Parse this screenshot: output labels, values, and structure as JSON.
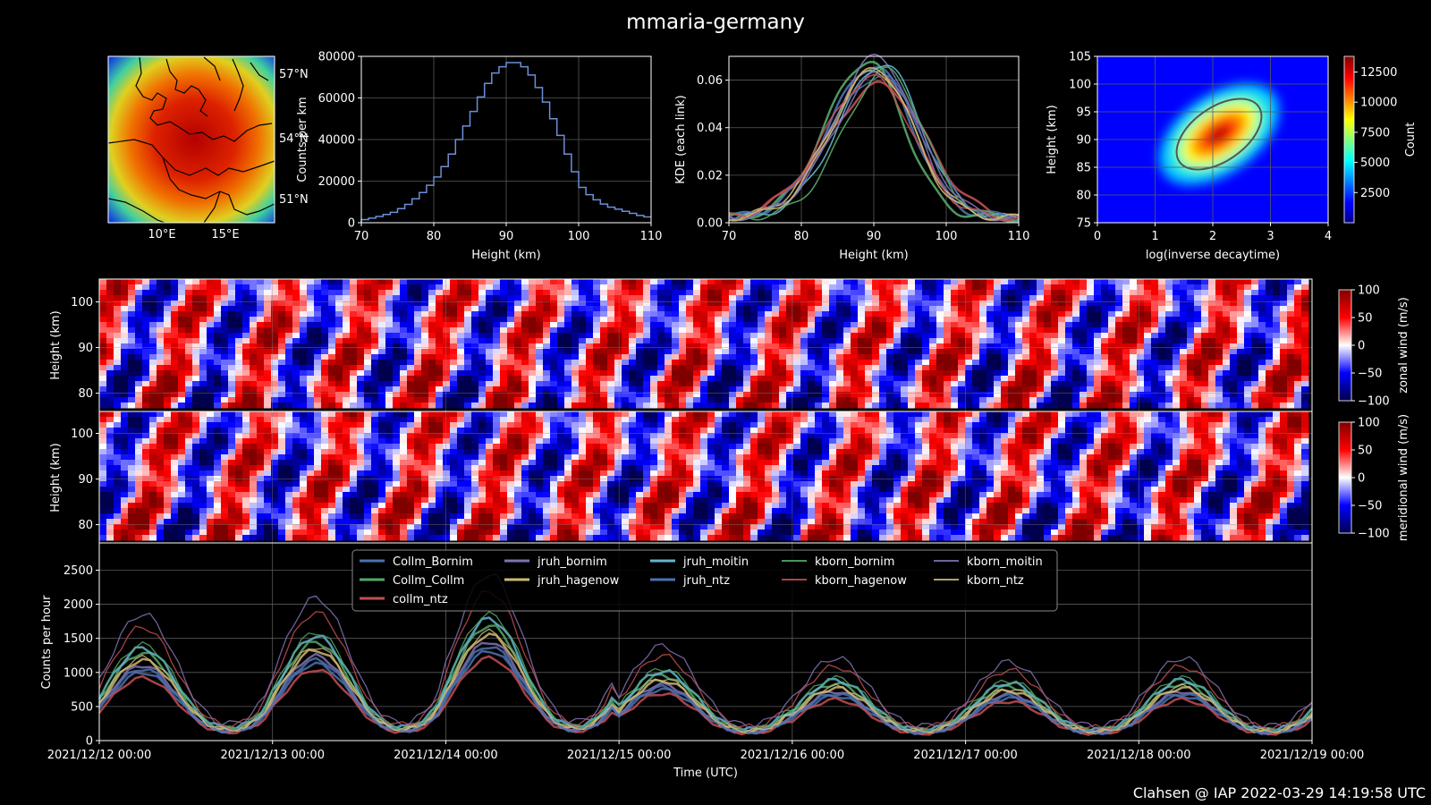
{
  "figure": {
    "title": "mmaria-germany",
    "footer": "Clahsen @ IAP 2022-03-29 14:19:58 UTC"
  },
  "colors": {
    "background": "#000000",
    "hist_line": "#6b8fd6",
    "ellipse": "#555555"
  },
  "chart_data": [
    {
      "type": "heatmap",
      "panel": "map",
      "xticks": [
        "10°E",
        "15°E"
      ],
      "yticks": [
        "57°N",
        "54°N",
        "51°N"
      ],
      "colormap": "jet"
    },
    {
      "type": "bar",
      "panel": "histogram",
      "xlabel": "Height (km)",
      "ylabel": "Counts per km",
      "xlim": [
        70,
        110
      ],
      "ylim": [
        0,
        80000
      ],
      "xticks": [
        "70",
        "80",
        "90",
        "100",
        "110"
      ],
      "yticks": [
        "0",
        "20000",
        "40000",
        "60000",
        "80000"
      ],
      "grid": true,
      "bins": [
        70,
        71,
        72,
        73,
        74,
        75,
        76,
        77,
        78,
        79,
        80,
        81,
        82,
        83,
        84,
        85,
        86,
        87,
        88,
        89,
        90,
        91,
        92,
        93,
        94,
        95,
        96,
        97,
        98,
        99,
        100,
        101,
        102,
        103,
        104,
        105,
        106,
        107,
        108,
        109
      ],
      "values": [
        1500,
        2200,
        3000,
        4000,
        5000,
        6800,
        8800,
        11500,
        14500,
        18000,
        22000,
        27000,
        33000,
        40000,
        46500,
        53500,
        60500,
        67000,
        72000,
        75000,
        77000,
        77000,
        75000,
        71000,
        65000,
        58000,
        50000,
        42000,
        33000,
        24500,
        17000,
        13500,
        11000,
        9000,
        7500,
        6500,
        5500,
        4500,
        3500,
        2800
      ]
    },
    {
      "type": "line",
      "panel": "kde",
      "xlabel": "Height (km)",
      "ylabel": "KDE (each link)",
      "xlim": [
        70,
        110
      ],
      "ylim": [
        0,
        0.07
      ],
      "xticks": [
        "70",
        "80",
        "90",
        "100",
        "110"
      ],
      "yticks": [
        "0.00",
        "0.02",
        "0.04",
        "0.06"
      ],
      "grid": true,
      "series": [
        {
          "color": "#4c72b0",
          "width": 2.5,
          "peak": 90.0,
          "sigma": 6.2,
          "amp": 0.064
        },
        {
          "color": "#55a868",
          "width": 2.5,
          "peak": 89.2,
          "sigma": 5.8,
          "amp": 0.066
        },
        {
          "color": "#c44e52",
          "width": 2.5,
          "peak": 91.0,
          "sigma": 7.3,
          "amp": 0.056
        },
        {
          "color": "#8172b2",
          "width": 1.6,
          "peak": 90.5,
          "sigma": 6.0,
          "amp": 0.068
        },
        {
          "color": "#ccb974",
          "width": 1.6,
          "peak": 90.2,
          "sigma": 6.3,
          "amp": 0.062
        },
        {
          "color": "#64b5cd",
          "width": 1.6,
          "peak": 91.3,
          "sigma": 6.1,
          "amp": 0.065
        },
        {
          "color": "#4c72b0",
          "width": 1.6,
          "peak": 90.8,
          "sigma": 6.7,
          "amp": 0.06
        },
        {
          "color": "#55a868",
          "width": 1.6,
          "peak": 91.8,
          "sigma": 5.9,
          "amp": 0.062
        },
        {
          "color": "#c44e52",
          "width": 1.6,
          "peak": 89.8,
          "sigma": 6.6,
          "amp": 0.059
        },
        {
          "color": "#8172b2",
          "width": 1.6,
          "peak": 91.0,
          "sigma": 6.4,
          "amp": 0.061
        },
        {
          "color": "#ccb974",
          "width": 1.6,
          "peak": 90.3,
          "sigma": 6.0,
          "amp": 0.063
        }
      ]
    },
    {
      "type": "heatmap",
      "panel": "decay",
      "xlabel": "log(inverse decaytime)",
      "ylabel": "Height (km)",
      "xlim": [
        0,
        4
      ],
      "ylim": [
        75,
        105
      ],
      "xticks": [
        "0",
        "1",
        "2",
        "3",
        "4"
      ],
      "yticks": [
        "75",
        "80",
        "85",
        "90",
        "95",
        "100",
        "105"
      ],
      "center": [
        2.4,
        91.5
      ],
      "colorbar_label": "Count",
      "colorbar_ticks": [
        "2500",
        "5000",
        "7500",
        "10000",
        "12500"
      ],
      "colorbar_max": 13800,
      "colormap": "jet"
    },
    {
      "type": "heatmap",
      "panel": "zonal",
      "ylabel": "Height (km)",
      "yticks": [
        "80",
        "90",
        "100"
      ],
      "ylim": [
        76,
        105
      ],
      "colorbar_label": "zonal wind (m/s)",
      "colorbar_ticks": [
        "100",
        "50",
        "0",
        "−50",
        "−100"
      ],
      "clim": [
        -100,
        100
      ],
      "colormap": "seismic"
    },
    {
      "type": "heatmap",
      "panel": "meridional",
      "ylabel": "Height (km)",
      "yticks": [
        "80",
        "90",
        "100"
      ],
      "ylim": [
        76,
        105
      ],
      "colorbar_label": "meridional wind (m/s)",
      "colorbar_ticks": [
        "100",
        "50",
        "0",
        "−50",
        "−100"
      ],
      "clim": [
        -100,
        100
      ],
      "colormap": "seismic"
    },
    {
      "type": "line",
      "panel": "counts",
      "xlabel": "Time (UTC)",
      "ylabel": "Counts per hour",
      "ylim": [
        0,
        2900
      ],
      "yticks": [
        "0",
        "500",
        "1000",
        "1500",
        "2000",
        "2500"
      ],
      "xticks": [
        "2021/12/12 00:00",
        "2021/12/13 00:00",
        "2021/12/14 00:00",
        "2021/12/15 00:00",
        "2021/12/16 00:00",
        "2021/12/17 00:00",
        "2021/12/18 00:00",
        "2021/12/19 00:00"
      ],
      "grid": true,
      "legend_position": "top-center",
      "daily_peaks": [
        1450,
        1650,
        1950,
        1050,
        900,
        850,
        900
      ],
      "series": [
        {
          "name": "Collm_Bornim",
          "color": "#4c72b0",
          "width": 2.5,
          "scale": 0.78
        },
        {
          "name": "Collm_Collm",
          "color": "#55a868",
          "width": 2.5,
          "scale": 1.0
        },
        {
          "name": "collm_ntz",
          "color": "#c44e52",
          "width": 2.5,
          "scale": 0.72
        },
        {
          "name": "jruh_bornim",
          "color": "#8172b2",
          "width": 2.5,
          "scale": 0.86
        },
        {
          "name": "jruh_hagenow",
          "color": "#ccb974",
          "width": 2.5,
          "scale": 0.92
        },
        {
          "name": "jruh_moitin",
          "color": "#64b5cd",
          "width": 2.5,
          "scale": 1.06
        },
        {
          "name": "jruh_ntz",
          "color": "#4c72b0",
          "width": 2.5,
          "scale": 0.82
        },
        {
          "name": "kborn_bornim",
          "color": "#55a868",
          "width": 1.3,
          "scale": 1.1
        },
        {
          "name": "kborn_hagenow",
          "color": "#c44e52",
          "width": 1.3,
          "scale": 1.3
        },
        {
          "name": "kborn_moitin",
          "color": "#8172b2",
          "width": 1.3,
          "scale": 1.45
        },
        {
          "name": "kborn_ntz",
          "color": "#ccb974",
          "width": 1.3,
          "scale": 0.95
        }
      ]
    }
  ]
}
